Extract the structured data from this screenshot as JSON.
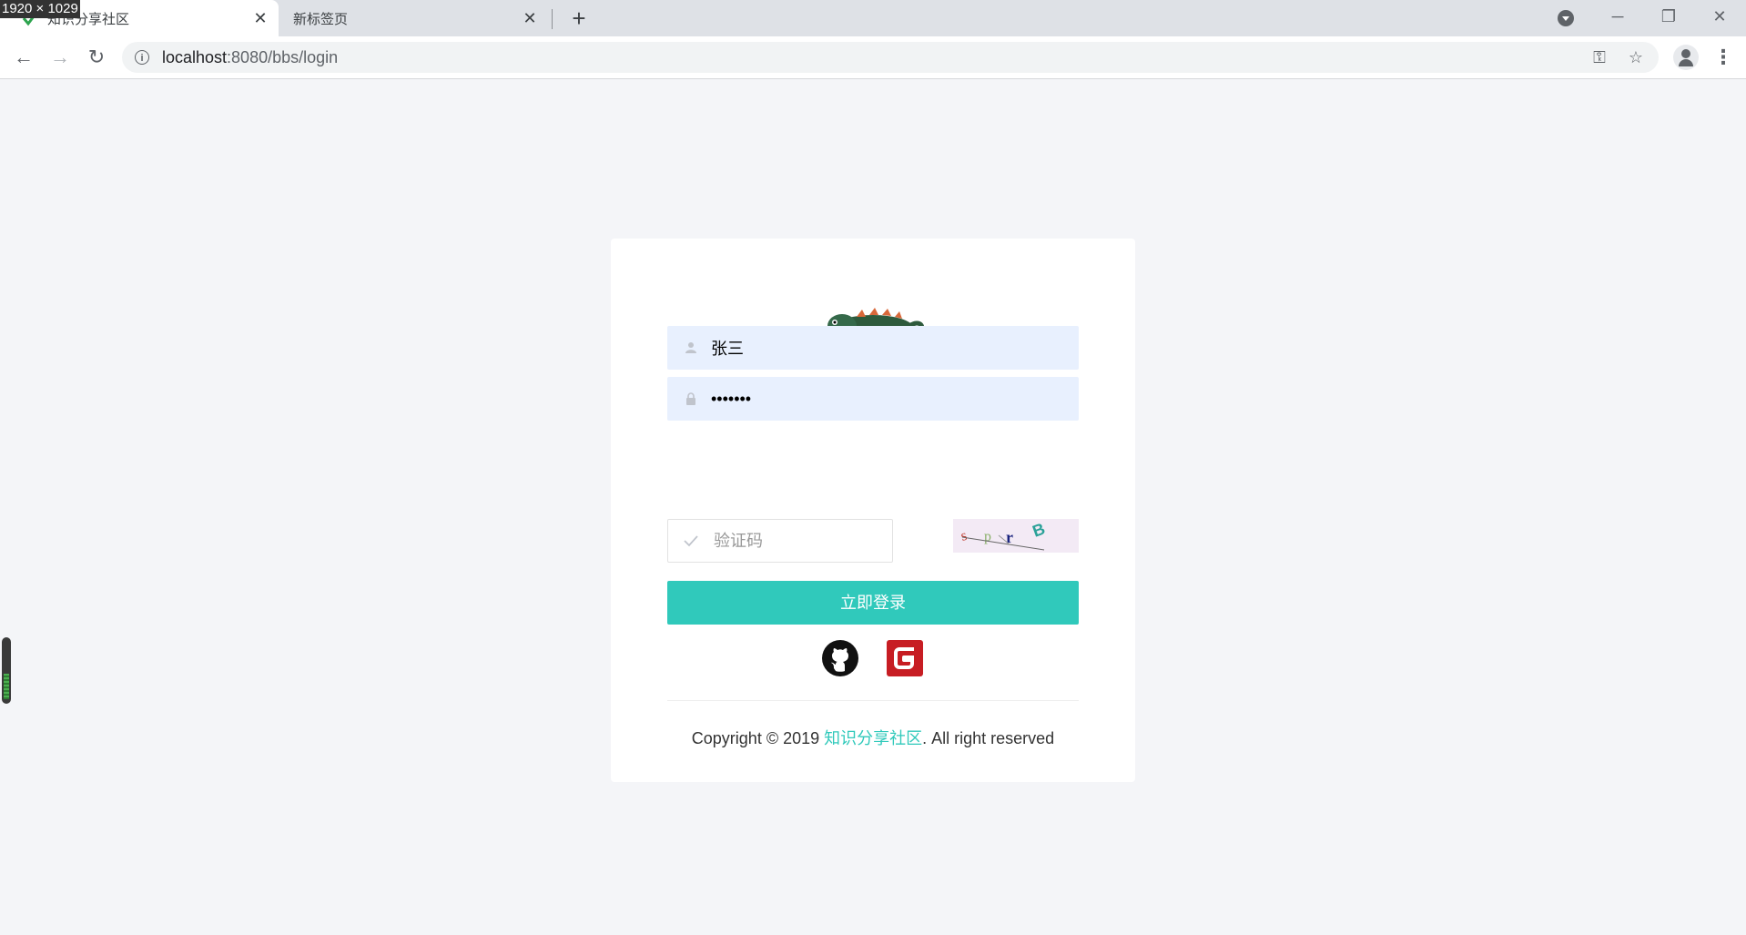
{
  "screen_badge": "1920 × 1029",
  "browser": {
    "tabs": [
      {
        "title": "知识分享社区",
        "active": true
      },
      {
        "title": "新标签页",
        "active": false
      }
    ],
    "new_tab_icon": "+",
    "url_host": "localhost",
    "url_path": ":8080/bbs/login",
    "window_controls": {
      "minimize": "─",
      "restore": "❐",
      "close": "✕"
    }
  },
  "login": {
    "username": "张三",
    "password_masked": "•••••••",
    "captcha_placeholder": "验证码",
    "captcha_text": "s p r B",
    "login_button": "立即登录",
    "social": [
      "github-icon",
      "gitee-icon"
    ]
  },
  "footer": {
    "prefix": "Copyright © 2019 ",
    "brand": "知识分享社区",
    "suffix": ". All right reserved"
  },
  "colors": {
    "accent": "#30c9bb",
    "input_filled_bg": "#e8f0fe",
    "page_bg": "#f4f5f8"
  }
}
